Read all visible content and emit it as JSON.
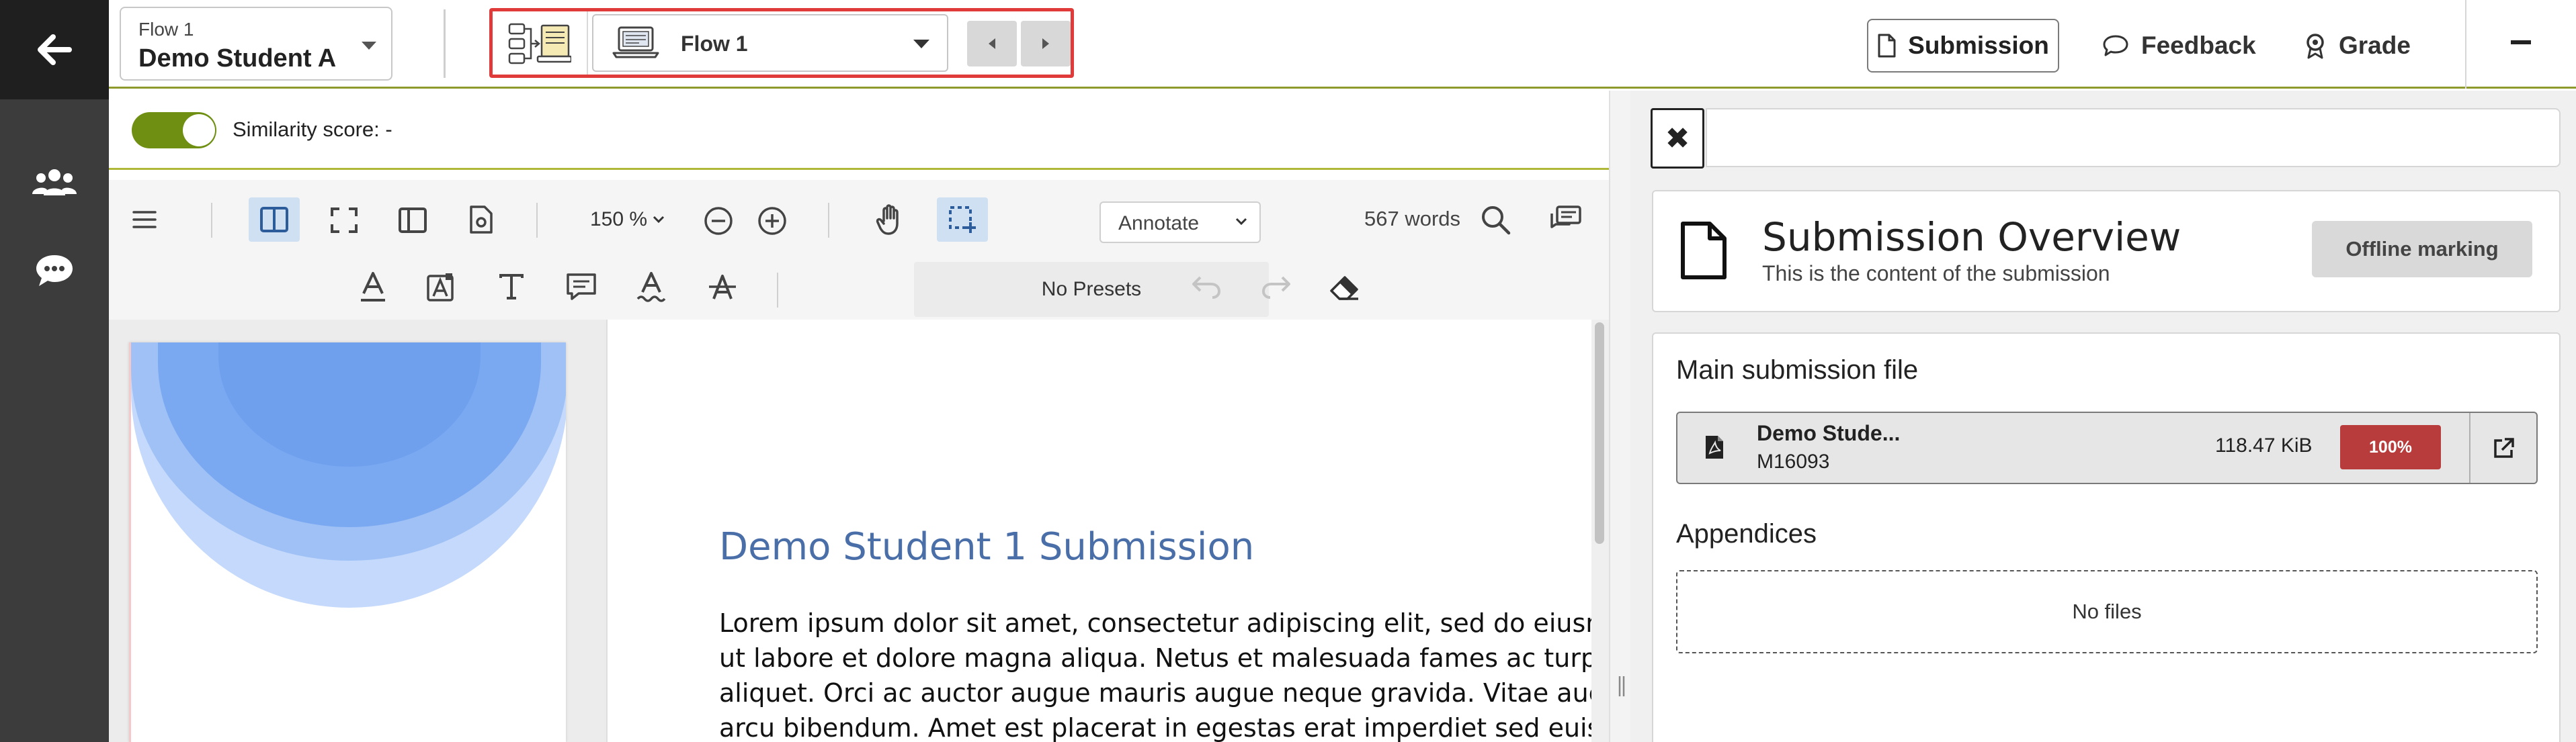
{
  "rail": {
    "back_icon": "arrow-left-icon",
    "items": [
      {
        "icon": "users-icon"
      },
      {
        "icon": "chat-bubble-icon"
      }
    ]
  },
  "header": {
    "student_select": {
      "small_label": "Flow 1",
      "value": "Demo Student A"
    },
    "flow_switcher": {
      "icon": "flow-diagram-icon",
      "dropdown_icon": "laptop-icon",
      "dropdown_value": "Flow 1"
    },
    "tabs": {
      "submission": "Submission",
      "feedback": "Feedback",
      "grade": "Grade"
    }
  },
  "similarity": {
    "label": "Similarity score: -",
    "enabled": true
  },
  "toolbar": {
    "zoom_label": "150 %",
    "annotate_label": "Annotate",
    "word_count": "567 words",
    "presets_label": "No Presets"
  },
  "document": {
    "title": "Demo Student 1 Submission",
    "lines": [
      "Lorem ipsum dolor sit amet, consectetur adipiscing elit, sed do eiusmod tempor incididunt",
      "ut labore et dolore magna aliqua. Netus et malesuada fames ac turpis egestas integer",
      "aliquet. Orci ac auctor augue mauris augue neque gravida. Vitae auctor eu augue ut lectus",
      "arcu bibendum. Amet est placerat in egestas erat imperdiet sed euismod nisi porta lorem"
    ]
  },
  "right_panel": {
    "close_label": "✖",
    "overview": {
      "title": "Submission Overview",
      "subtitle": "This is the content of the submission",
      "offline_button": "Offline marking"
    },
    "main_file": {
      "heading": "Main submission file",
      "name": "Demo Stude...",
      "id": "M16093",
      "size": "118.47 KiB",
      "badge": "100%",
      "badge_color": "#b83c3c"
    },
    "appendices": {
      "heading": "Appendices",
      "empty_label": "No files"
    }
  },
  "colors": {
    "rail": "#3c3c3c",
    "accent_olive": "#8e9a2c",
    "toggle_on": "#6e8f12",
    "highlight_red": "#e03a3a",
    "doc_title": "#4a6fa8"
  }
}
